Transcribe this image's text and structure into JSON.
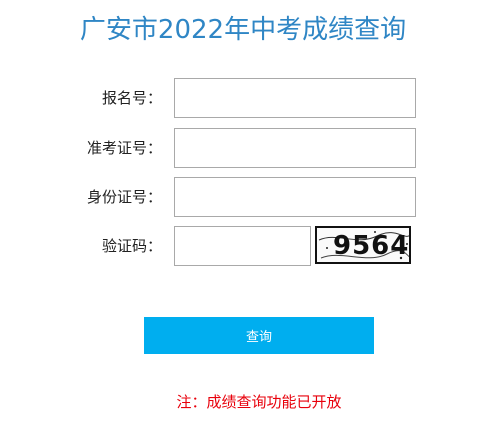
{
  "page_title": "广安市2022年中考成绩查询",
  "form": {
    "registration_number_label": "报名号：",
    "exam_admission_number_label": "准考证号：",
    "id_number_label": "身份证号：",
    "verification_code_label": "验证码：",
    "registration_number_value": "",
    "exam_admission_number_value": "",
    "id_number_value": "",
    "verification_code_value": "",
    "captcha_text": "9564"
  },
  "submit_button_label": "查询",
  "notice_text": "注：成绩查询功能已开放",
  "colors": {
    "title": "#2f86c5",
    "button": "#00aeef",
    "notice": "#e8000b"
  }
}
